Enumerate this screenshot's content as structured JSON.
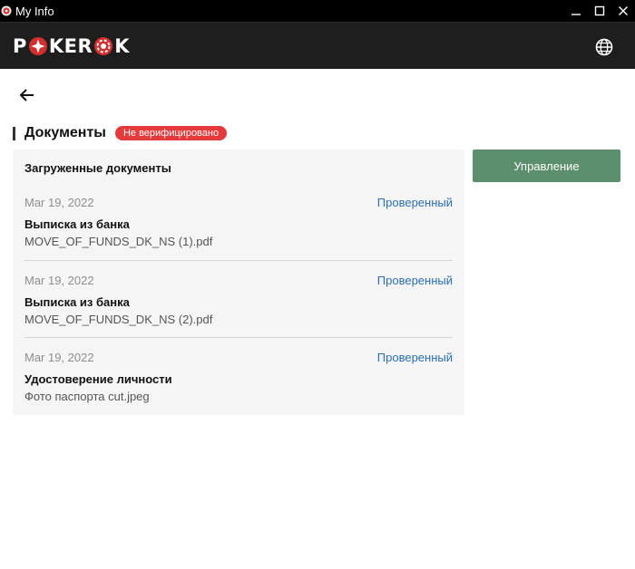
{
  "window": {
    "title": "My Info",
    "icon": "pokerok-app-icon",
    "controls": [
      "minimize-icon",
      "maximize-icon",
      "close-icon"
    ]
  },
  "header": {
    "logo_text": "POKEROK",
    "language_icon": "globe-icon"
  },
  "nav": {
    "back_icon": "arrow-left-icon"
  },
  "section": {
    "title": "Документы",
    "badge": "Не верифицировано",
    "badge_color": "#e5393b"
  },
  "card": {
    "title": "Загруженные документы",
    "documents": [
      {
        "date": "Mar 19, 2022",
        "status": "Проверенный",
        "name": "Выписка из банка",
        "file": "MOVE_OF_FUNDS_DK_NS (1).pdf"
      },
      {
        "date": "Mar 19, 2022",
        "status": "Проверенный",
        "name": "Выписка из банка",
        "file": "MOVE_OF_FUNDS_DK_NS (2).pdf"
      },
      {
        "date": "Mar 19, 2022",
        "status": "Проверенный",
        "name": "Удостоверение личности",
        "file": "Фото паспорта cut.jpeg"
      }
    ]
  },
  "actions": {
    "manage_label": "Управление",
    "manage_color": "#5b8f6e"
  },
  "colors": {
    "header_bg": "#1e1e1e",
    "link": "#2a6fb8"
  }
}
